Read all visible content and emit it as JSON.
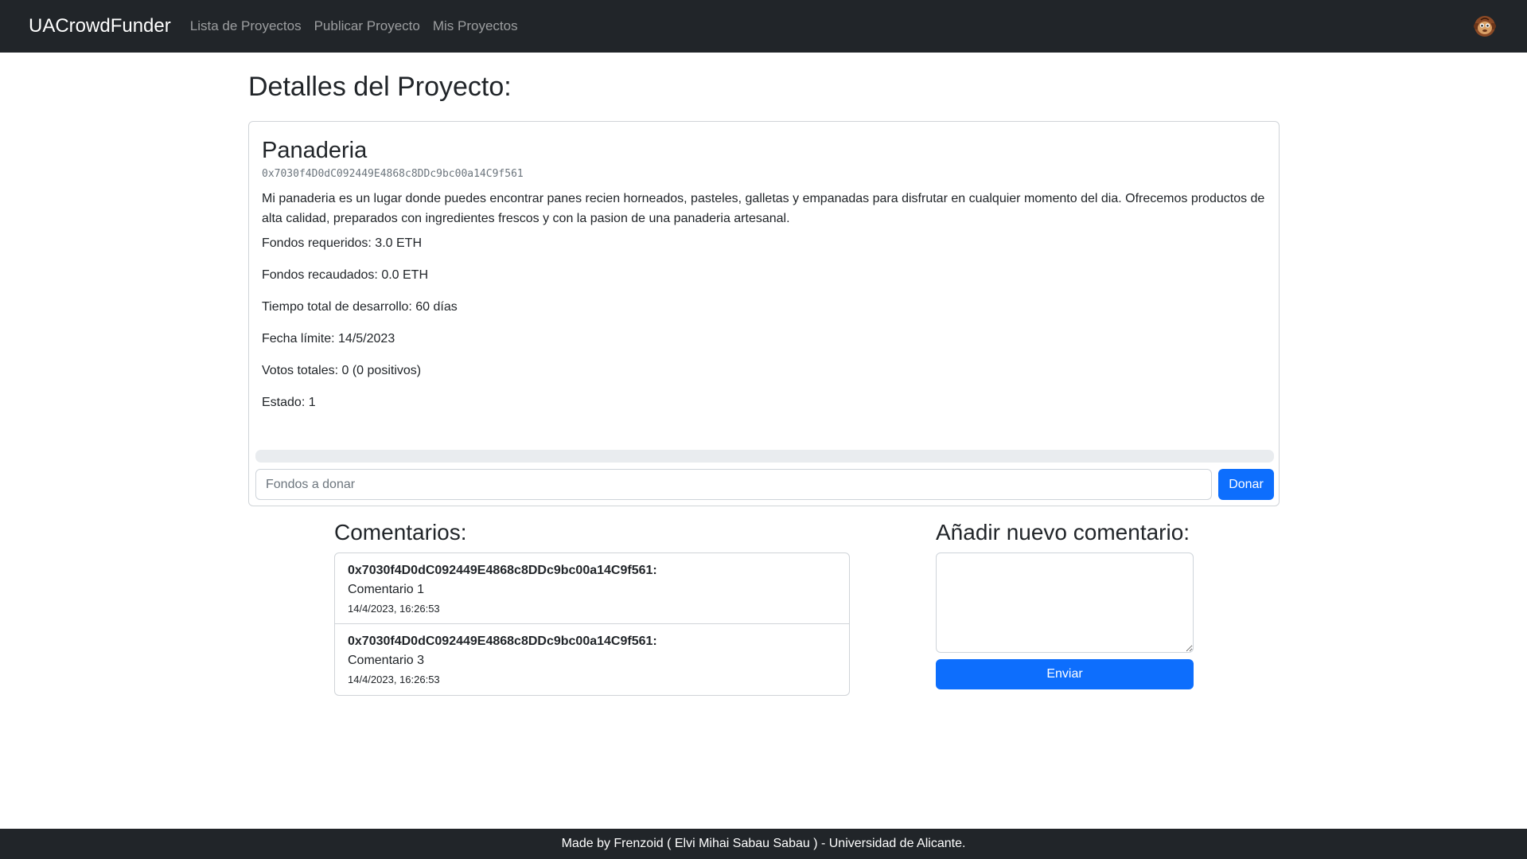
{
  "navbar": {
    "brand": "UACrowdFunder",
    "links": [
      "Lista de Proyectos",
      "Publicar Proyecto",
      "Mis Proyectos"
    ],
    "avatar_icon": "monkey-avatar-icon"
  },
  "page_title": "Detalles del Proyecto:",
  "project": {
    "name": "Panaderia",
    "address": "0x7030f4D0dC092449E4868c8DDc9bc00a14C9f561",
    "description": "Mi panaderia es un lugar donde puedes encontrar panes recien horneados, pasteles, galletas y empanadas para disfrutar en cualquier momento del dia. Ofrecemos productos de alta calidad, preparados con ingredientes frescos y con la pasion de una panaderia artesanal.",
    "required": "Fondos requeridos: 3.0 ETH",
    "raised": "Fondos recaudados: 0.0 ETH",
    "duration": "Tiempo total de desarrollo: 60 días",
    "deadline": "Fecha límite: 14/5/2023",
    "votes": "Votos totales: 0 (0 positivos)",
    "status": "Estado: 1",
    "progress_percent": 0
  },
  "donate": {
    "placeholder": "Fondos a donar",
    "button_label": "Donar"
  },
  "comments": {
    "title": "Comentarios:",
    "items": [
      {
        "author": "0x7030f4D0dC092449E4868c8DDc9bc00a14C9f561:",
        "text": "Comentario 1",
        "date": "14/4/2023, 16:26:53"
      },
      {
        "author": "0x7030f4D0dC092449E4868c8DDc9bc00a14C9f561:",
        "text": "Comentario 3",
        "date": "14/4/2023, 16:26:53"
      }
    ]
  },
  "new_comment": {
    "title": "Añadir nuevo comentario:",
    "button_label": "Enviar"
  },
  "footer": {
    "text": "Made by Frenzoid ( Elvi Mihai Sabau Sabau ) - Universidad de Alicante."
  },
  "colors": {
    "navbar_bg": "#212529",
    "primary": "#0d6efd",
    "border": "#d0d4d8"
  }
}
